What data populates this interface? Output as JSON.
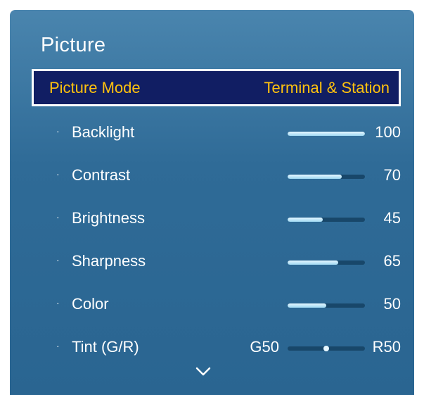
{
  "menu": {
    "title": "Picture",
    "picture_mode": {
      "label": "Picture Mode",
      "value": "Terminal & Station"
    },
    "items": [
      {
        "bullet": "·",
        "label": "Backlight",
        "value": "100",
        "level": 100
      },
      {
        "bullet": "·",
        "label": "Contrast",
        "value": "70",
        "level": 70
      },
      {
        "bullet": "·",
        "label": "Brightness",
        "value": "45",
        "level": 45
      },
      {
        "bullet": "·",
        "label": "Sharpness",
        "value": "65",
        "level": 65
      },
      {
        "bullet": "·",
        "label": "Color",
        "value": "50",
        "level": 50
      }
    ],
    "tint": {
      "bullet": "·",
      "label": "Tint (G/R)",
      "left_value": "G50",
      "right_value": "R50",
      "balance": 0.5
    },
    "scroll_icon": "chevron-down-icon",
    "colors": {
      "highlight_text": "#ffc20e",
      "highlight_bg": "#111e63",
      "panel": "#2f6b97"
    }
  }
}
